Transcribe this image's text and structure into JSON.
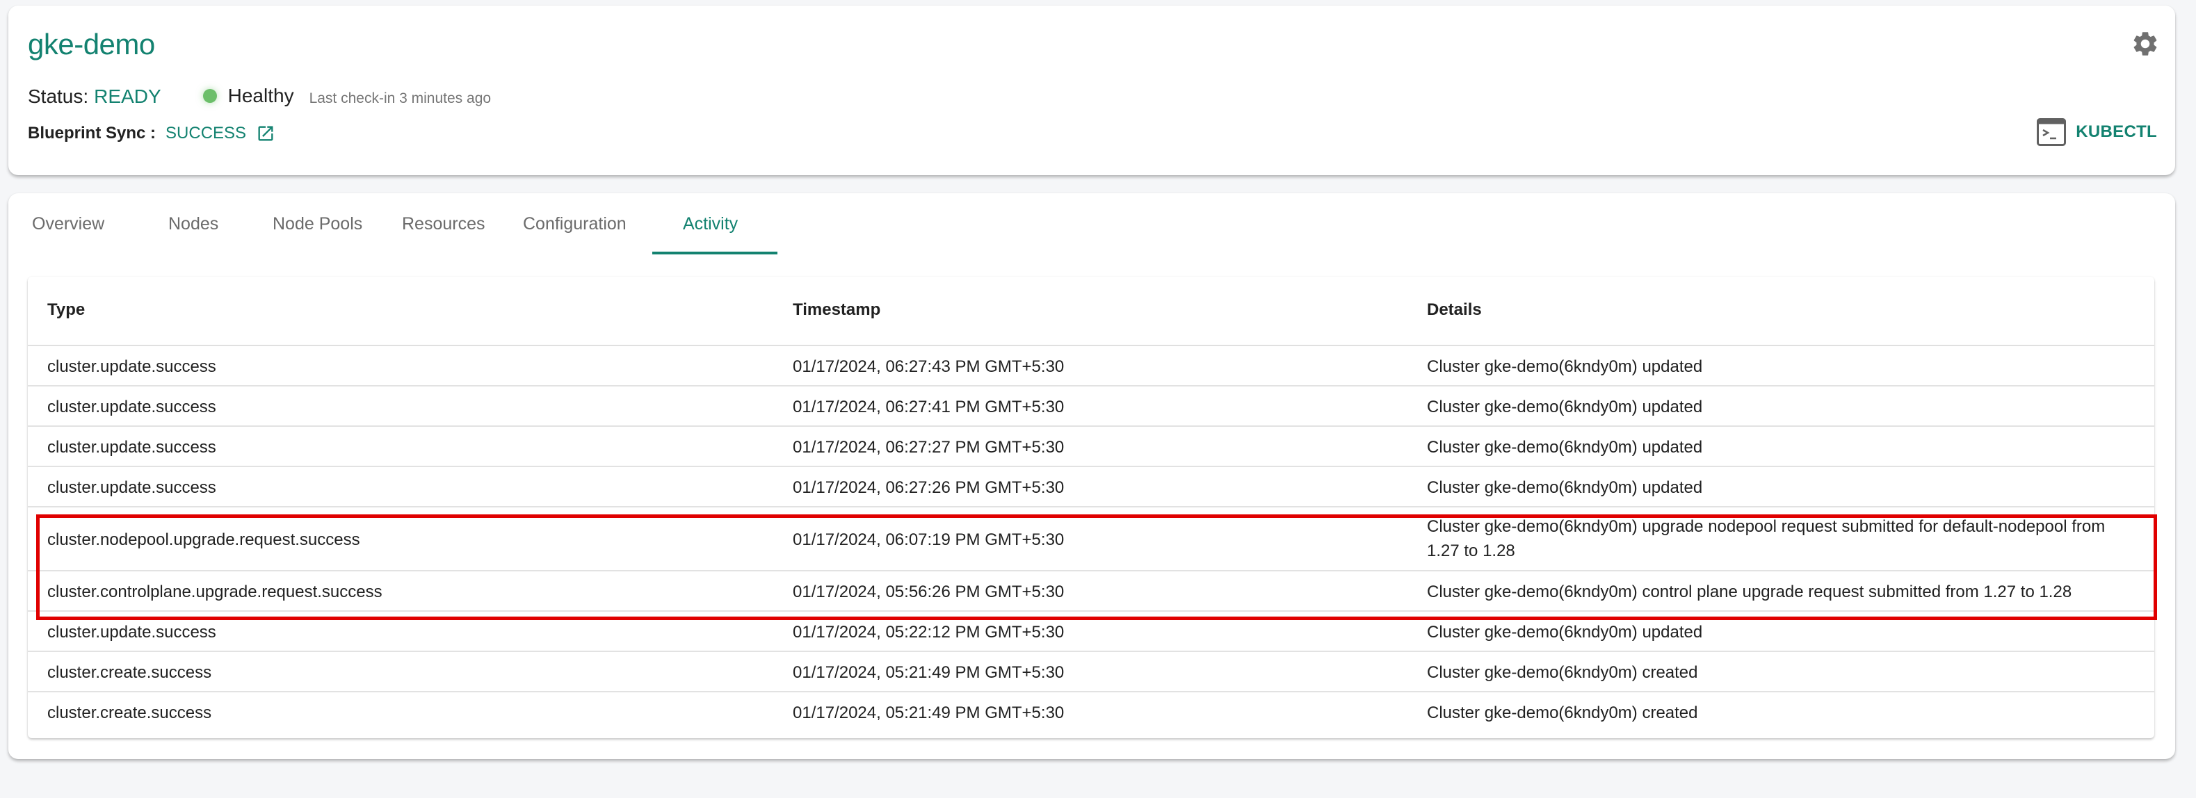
{
  "header": {
    "title": "gke-demo",
    "status_label": "Status:",
    "status_value": "READY",
    "health": "Healthy",
    "last_checkin": "Last check-in 3 minutes ago",
    "blueprint_label": "Blueprint Sync :",
    "blueprint_value": "SUCCESS",
    "kubectl_label": "KUBECTL",
    "icons": {
      "settings": "gear-icon",
      "blueprint_link": "external-link-icon",
      "kubectl": "terminal-icon"
    }
  },
  "colors": {
    "accent": "#138270",
    "healthy": "#6cbf6a",
    "highlight": "#e00000"
  },
  "tabs": [
    {
      "label": "Overview",
      "active": false
    },
    {
      "label": "Nodes",
      "active": false
    },
    {
      "label": "Node Pools",
      "active": false
    },
    {
      "label": "Resources",
      "active": false
    },
    {
      "label": "Configuration",
      "active": false
    },
    {
      "label": "Activity",
      "active": true
    }
  ],
  "table": {
    "columns": [
      "Type",
      "Timestamp",
      "Details"
    ],
    "rows": [
      {
        "type": "cluster.update.success",
        "timestamp": "01/17/2024, 06:27:43 PM GMT+5:30",
        "details": "Cluster gke-demo(6kndy0m) updated"
      },
      {
        "type": "cluster.update.success",
        "timestamp": "01/17/2024, 06:27:41 PM GMT+5:30",
        "details": "Cluster gke-demo(6kndy0m) updated"
      },
      {
        "type": "cluster.update.success",
        "timestamp": "01/17/2024, 06:27:27 PM GMT+5:30",
        "details": "Cluster gke-demo(6kndy0m) updated"
      },
      {
        "type": "cluster.update.success",
        "timestamp": "01/17/2024, 06:27:26 PM GMT+5:30",
        "details": "Cluster gke-demo(6kndy0m) updated"
      },
      {
        "type": "cluster.nodepool.upgrade.request.success",
        "timestamp": "01/17/2024, 06:07:19 PM GMT+5:30",
        "details": "Cluster gke-demo(6kndy0m) upgrade nodepool request submitted for default-nodepool from 1.27 to 1.28",
        "highlighted": true
      },
      {
        "type": "cluster.controlplane.upgrade.request.success",
        "timestamp": "01/17/2024, 05:56:26 PM GMT+5:30",
        "details": "Cluster gke-demo(6kndy0m) control plane upgrade request submitted from 1.27 to 1.28",
        "highlighted": true
      },
      {
        "type": "cluster.update.success",
        "timestamp": "01/17/2024, 05:22:12 PM GMT+5:30",
        "details": "Cluster gke-demo(6kndy0m) updated"
      },
      {
        "type": "cluster.create.success",
        "timestamp": "01/17/2024, 05:21:49 PM GMT+5:30",
        "details": "Cluster gke-demo(6kndy0m) created"
      },
      {
        "type": "cluster.create.success",
        "timestamp": "01/17/2024, 05:21:49 PM GMT+5:30",
        "details": "Cluster gke-demo(6kndy0m) created"
      }
    ]
  }
}
